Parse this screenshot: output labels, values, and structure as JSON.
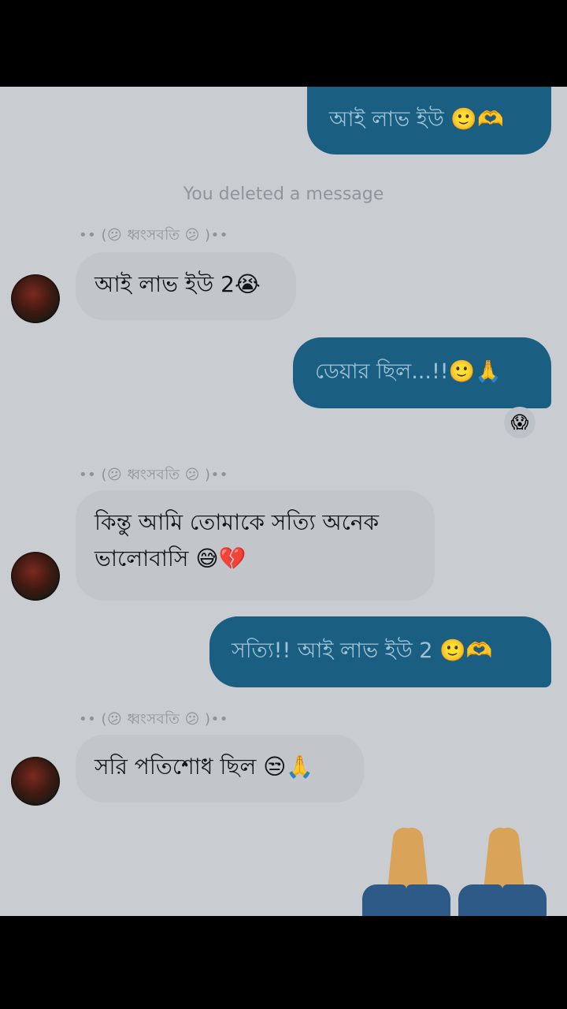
{
  "conversation": {
    "deleted_notice": "You deleted a message",
    "sender_label": "•• (😕 ধ্বংসবতি 😕 )••",
    "messages_out": [
      {
        "text": "আই লাভ ইউ 🙂🫶"
      },
      {
        "text": "ডেয়ার ছিল...!!🙂🙏"
      },
      {
        "text": "সত্যি!! আই লাভ ইউ 2 🙂🫶"
      }
    ],
    "messages_in": [
      {
        "text": "আই লাভ ইউ 2😭"
      },
      {
        "text": "কিন্তু আমি তোমাকে সত্যি অনেক ভালোবাসি 😅💔"
      },
      {
        "text": "সরি পতিশোধ ছিল 😒🙏"
      }
    ],
    "reaction": "😱"
  },
  "colors": {
    "outgoing_bubble": "#1a5e82",
    "incoming_bubble": "#c2c5ca",
    "background": "#c9ccd0"
  }
}
